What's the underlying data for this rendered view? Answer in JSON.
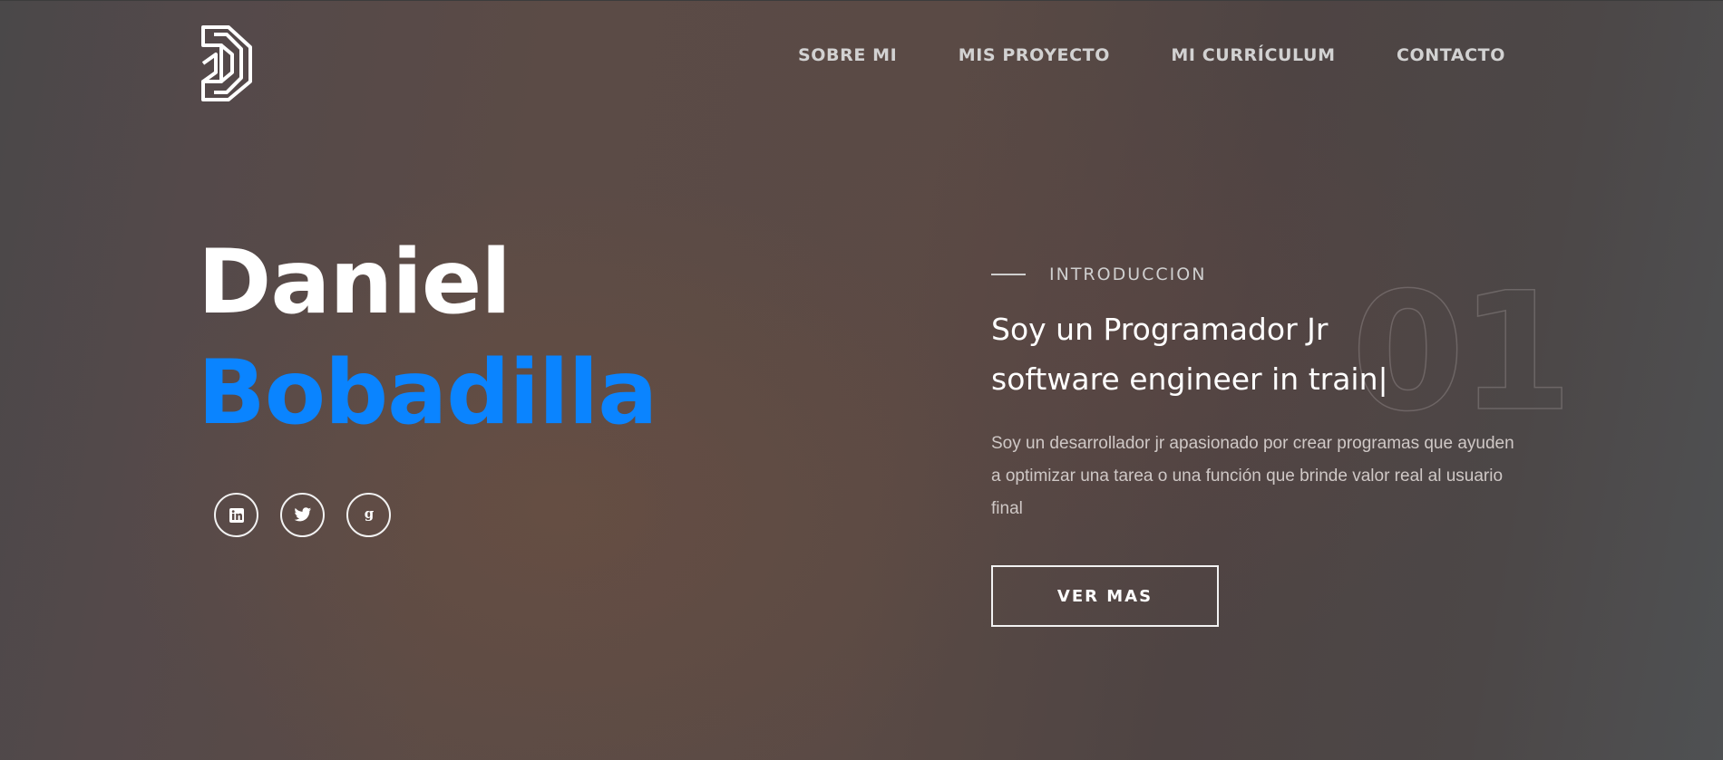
{
  "nav": {
    "logo_icon": "stylized-d-logo-icon",
    "items": [
      {
        "label": "SOBRE MI"
      },
      {
        "label": "MIS PROYECTO"
      },
      {
        "label": "MI CURRÍCULUM"
      },
      {
        "label": "CONTACTO"
      }
    ]
  },
  "hero": {
    "first_name": "Daniel",
    "last_name": "Bobadilla",
    "accent_color": "#0a84ff",
    "socials": [
      {
        "icon": "linkedin-icon"
      },
      {
        "icon": "twitter-icon"
      },
      {
        "icon": "google-icon"
      }
    ]
  },
  "intro": {
    "label": "INTRODUCCION",
    "number": "01",
    "headline_line1": "Soy un Programador Jr",
    "headline_line2": "software engineer in train|",
    "description": "Soy un desarrollador jr apasionado por crear programas que ayuden a optimizar una tarea o una función que brinde valor real al usuario final",
    "button_label": "VER MAS"
  }
}
